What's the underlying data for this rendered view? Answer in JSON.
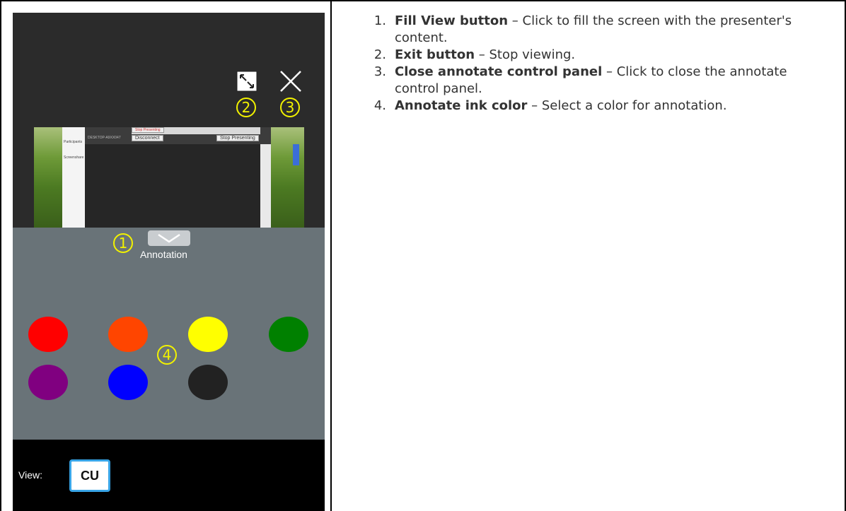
{
  "viewer": {
    "callouts": [
      "1",
      "2",
      "3",
      "4"
    ],
    "thumbnail": {
      "stop_presenting_small": "Stop Presenting",
      "disconnect": "Disconnect",
      "stop_presenting": "Stop Presenting",
      "device_name": "DESKTOP-A9XX047",
      "sidebar_items": [
        "Participants",
        "Screenshare"
      ]
    },
    "annotation_label": "Annotation",
    "ink_colors": [
      "#ff0000",
      "#ff4500",
      "#ffff00",
      "#008000",
      "#800080",
      "#0000ff",
      "#222222"
    ],
    "view_label": "View:",
    "view_button": "CU"
  },
  "descriptions": [
    {
      "num": "1.",
      "title": "Fill View button",
      "text": " – Click to fill the screen with the presenter's content."
    },
    {
      "num": "2.",
      "title": "Exit button",
      "text": " – Stop viewing."
    },
    {
      "num": "3.",
      "title": "Close annotate control panel",
      "text": " – Click to close the annotate control panel."
    },
    {
      "num": "4.",
      "title": "Annotate ink color",
      "text": " – Select a color for annotation."
    }
  ]
}
